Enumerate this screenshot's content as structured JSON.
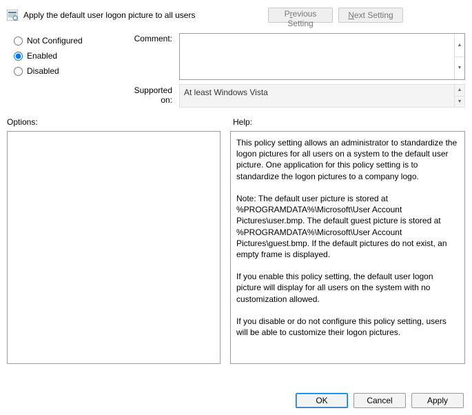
{
  "title": "Apply the default user logon picture to all users",
  "nav": {
    "previous_pre": "P",
    "previous_u": "r",
    "previous_post": "evious Setting",
    "next_pre": "",
    "next_u": "N",
    "next_post": "ext Setting"
  },
  "state": {
    "not_configured": "Not Configured",
    "enabled": "Enabled",
    "disabled": "Disabled",
    "selected": "enabled"
  },
  "labels": {
    "comment": "Comment:",
    "supported": "Supported on:",
    "options": "Options:",
    "help": "Help:"
  },
  "comment": "",
  "supported_on": "At least Windows Vista",
  "help_text": "This policy setting allows an administrator to standardize the logon pictures for all users on a system to the default user picture. One application for this policy setting is to standardize the logon pictures to a company logo.\n\nNote: The default user picture is stored at %PROGRAMDATA%\\Microsoft\\User Account Pictures\\user.bmp. The default guest picture is stored at %PROGRAMDATA%\\Microsoft\\User Account Pictures\\guest.bmp. If the default pictures do not exist, an empty frame is displayed.\n\nIf you enable this policy setting, the default user logon picture will display for all users on the system with no customization allowed.\n\nIf you disable or do not configure this policy setting, users will be able to customize their logon pictures.",
  "buttons": {
    "ok": "OK",
    "cancel": "Cancel",
    "apply": "Apply"
  }
}
